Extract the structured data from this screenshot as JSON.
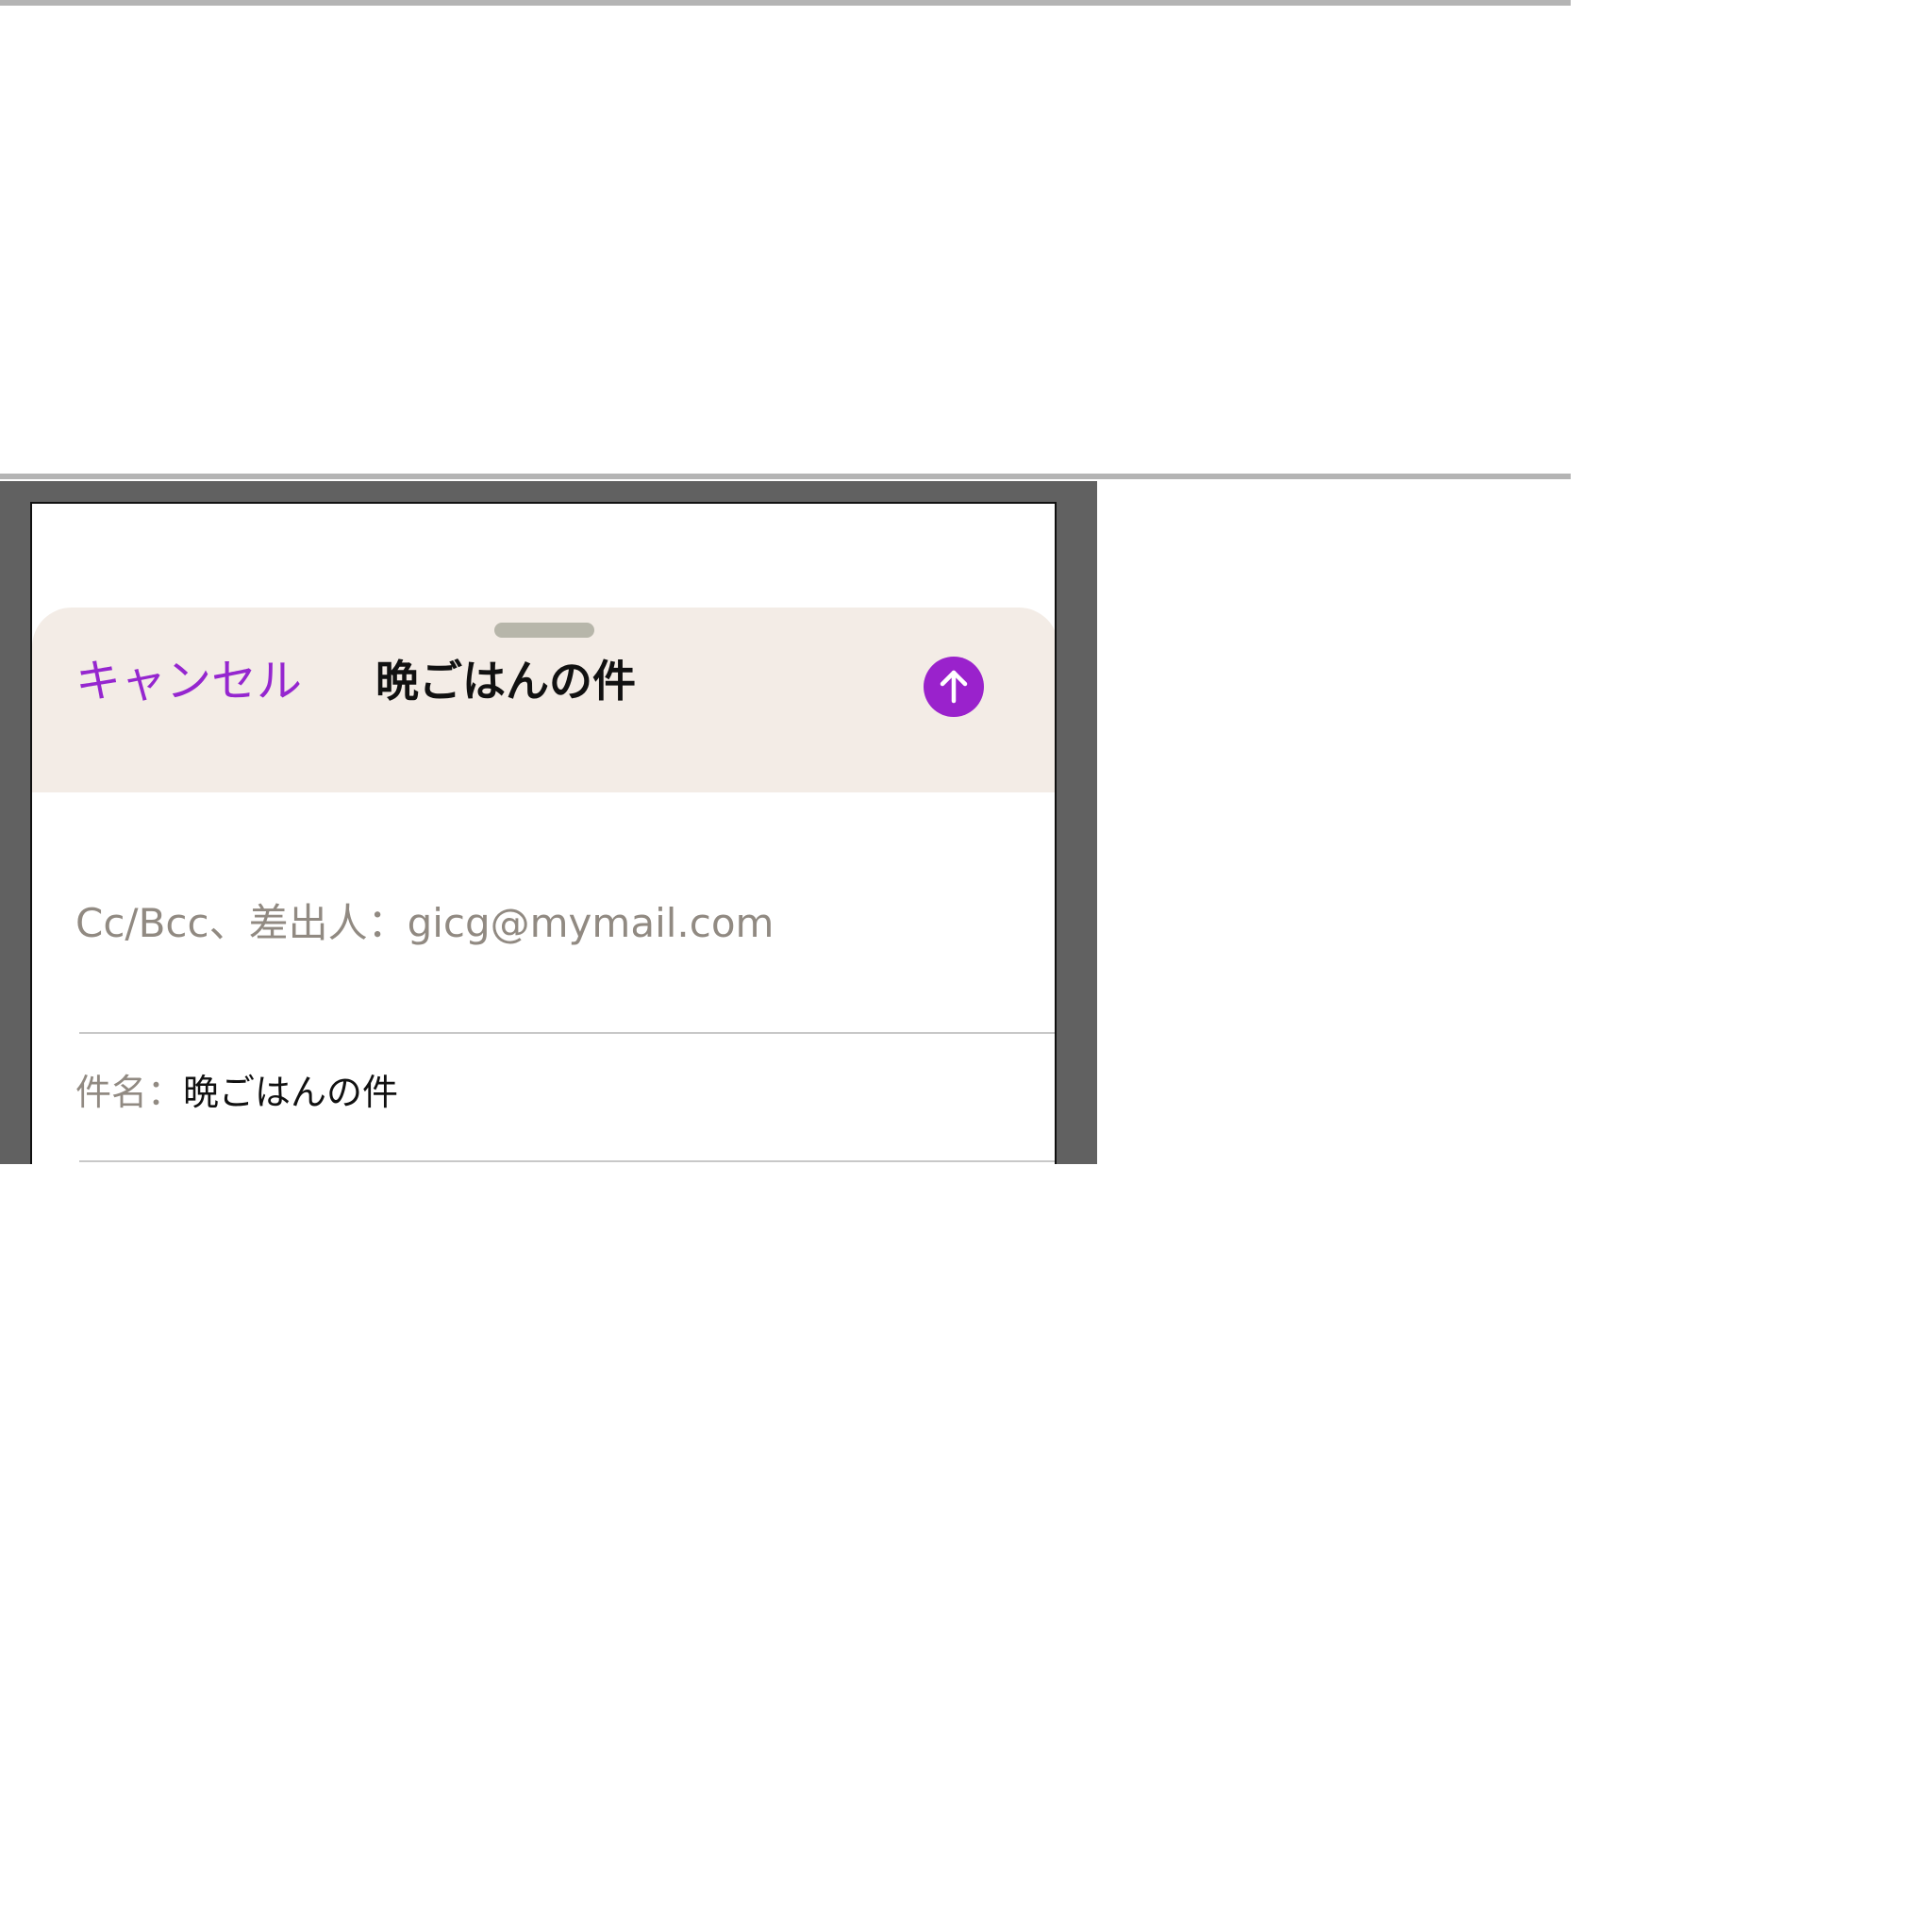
{
  "compose": {
    "cancel_label": "キャンセル",
    "title": "晩ごはんの件",
    "send_icon": "arrow-up-circle",
    "accent_color": "#9a22cc",
    "cc_bcc_from": "Cc/Bcc、差出人：gicg@mymail.com",
    "subject_label": "件名：",
    "subject_value": "晩ごはんの件"
  }
}
